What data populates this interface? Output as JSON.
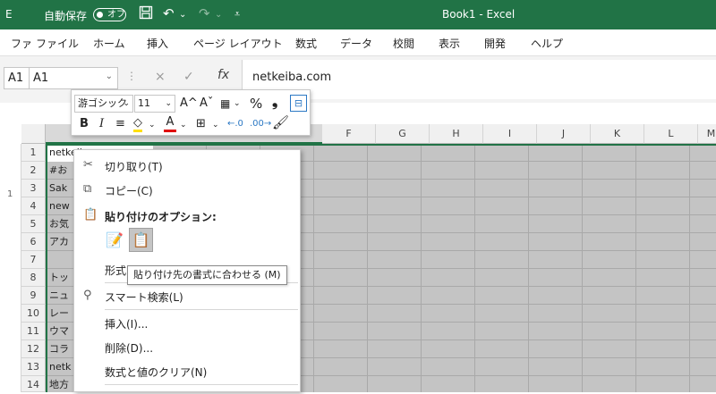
{
  "titlebar": {
    "app_letter": "E",
    "autosave_label": "自動保存",
    "autosave_state": "オフ",
    "save_icon": "save-icon",
    "undo_icon": "undo-icon",
    "redo_icon": "redo-icon",
    "customize_icon": "customize-icon",
    "doc_title": "Book1  -  Excel",
    "bg_color": "#217346"
  },
  "menu": {
    "items": [
      "ファ",
      "ファイル",
      "ホーム",
      "挿入",
      "ページ レイアウト",
      "数式",
      "データ",
      "校閲",
      "表示",
      "開発",
      "ヘルプ"
    ]
  },
  "formula_bar": {
    "left_name": "A1",
    "name_box": "A1",
    "cancel_icon": "×",
    "enter_icon": "✓",
    "fx": "fx",
    "value": "netkeiba.com"
  },
  "mini_toolbar": {
    "font_name": "游ゴシック",
    "font_size": "11",
    "grow": "A^",
    "shrink": "Aˇ",
    "percent": "%",
    "comma": "❟",
    "bold": "B",
    "italic": "I",
    "font_color_label": "A"
  },
  "columns": [
    "F",
    "G",
    "H",
    "I",
    "J",
    "K",
    "L",
    "M"
  ],
  "rows": [
    "1",
    "2",
    "3",
    "4",
    "5",
    "6",
    "7",
    "8",
    "9",
    "10",
    "11",
    "12",
    "13",
    "14"
  ],
  "outline": {
    "level": "1"
  },
  "cells": [
    "netkeiba.com",
    "#お",
    "Sak",
    "new",
    "お気",
    "アカ",
    "",
    "トッ",
    "ニュ",
    "レー",
    "ウマ",
    "コラ",
    "netk",
    "地方"
  ],
  "context_menu": {
    "cut": "切り取り(T)",
    "copy": "コピー(C)",
    "paste_options": "貼り付けのオプション:",
    "paste_format_partial": "形式",
    "smart_lookup": "スマート検索(L)",
    "insert": "挿入(I)...",
    "delete": "削除(D)...",
    "clear": "数式と値のクリア(N)"
  },
  "tooltip": "貼り付け先の書式に合わせる (M)",
  "colors": {
    "accent": "#217346",
    "selection_fill": "#c4c4c4"
  }
}
